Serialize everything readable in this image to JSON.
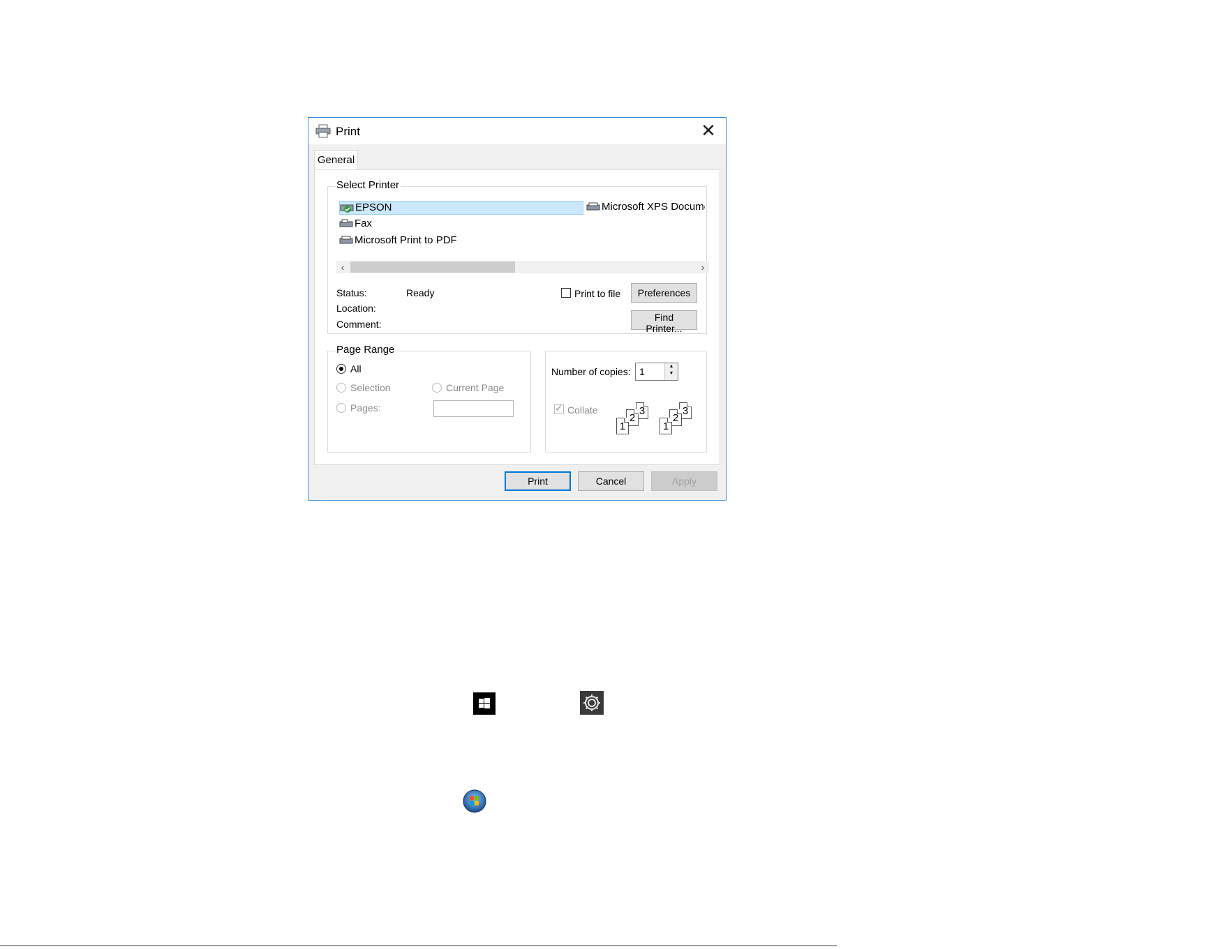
{
  "dialog": {
    "title": "Print",
    "close_icon": "close-icon",
    "tab_general": "General",
    "select_printer": {
      "group_title": "Select Printer",
      "printers": [
        {
          "name": "EPSON",
          "icon": "printer-default-icon",
          "selected": true
        },
        {
          "name": "Fax",
          "icon": "fax-icon",
          "selected": false
        },
        {
          "name": "Microsoft Print to PDF",
          "icon": "printer-icon",
          "selected": false
        },
        {
          "name": "Microsoft XPS Documen",
          "icon": "printer-icon",
          "selected": false
        }
      ],
      "status_label": "Status:",
      "status_value": "Ready",
      "location_label": "Location:",
      "comment_label": "Comment:",
      "print_to_file_label": "Print to file",
      "preferences_button": "Preferences",
      "find_printer_button": "Find Printer..."
    },
    "page_range": {
      "group_title": "Page Range",
      "all_label": "All",
      "selection_label": "Selection",
      "current_page_label": "Current Page",
      "pages_label": "Pages:"
    },
    "copies": {
      "number_label": "Number of copies:",
      "number_value": "1",
      "collate_label": "Collate",
      "collate_pages": [
        "1",
        "2",
        "3"
      ]
    },
    "buttons": {
      "print": "Print",
      "cancel": "Cancel",
      "apply": "Apply"
    }
  },
  "icons": {
    "windows10_start": "windows-start-icon",
    "settings": "gear-icon",
    "windows7_start": "windows7-orb-icon"
  },
  "colors": {
    "dialog_border": "#3c8cdc",
    "selection_fill": "#cce8ff",
    "default_button_border": "#0078d7"
  }
}
